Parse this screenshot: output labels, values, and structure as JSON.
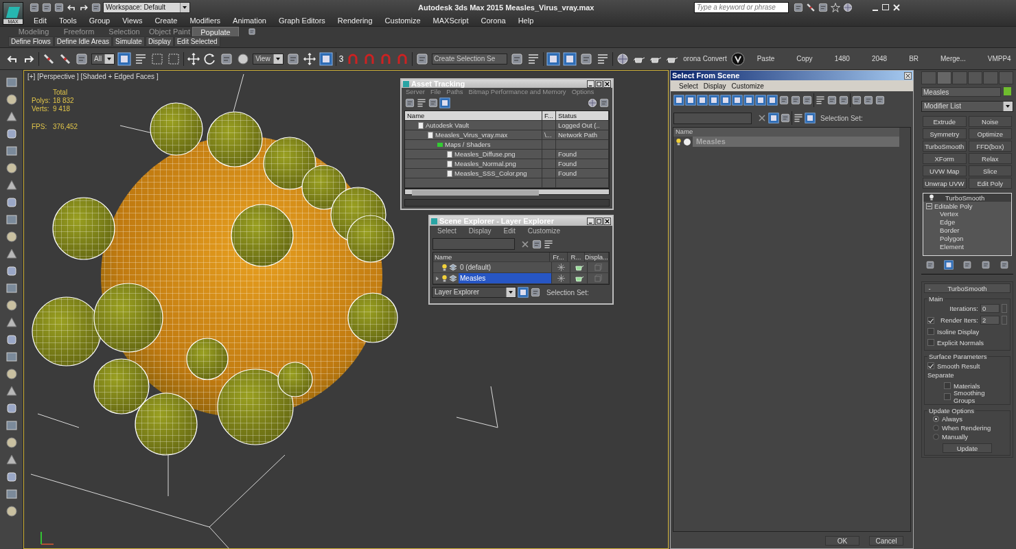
{
  "title_bar": {
    "logo_label": "MAX",
    "workspace": "Workspace: Default",
    "title": "Autodesk 3ds Max  2015    Measles_Virus_vray.max",
    "search": {
      "placeholder": "Type a keyword or phrase"
    }
  },
  "menu_bar": [
    "Edit",
    "Tools",
    "Group",
    "Views",
    "Create",
    "Modifiers",
    "Animation",
    "Graph Editors",
    "Rendering",
    "Customize",
    "MAXScript",
    "Corona",
    "Help"
  ],
  "ribbon": {
    "tabs": [
      {
        "label": "Modeling",
        "selected": false
      },
      {
        "label": "Freeform",
        "selected": false
      },
      {
        "label": "Selection",
        "selected": false
      },
      {
        "label": "Object Paint",
        "selected": false
      },
      {
        "label": "Populate",
        "selected": true
      }
    ],
    "buttons": [
      "Define Flows",
      "Define Idle Areas",
      "Simulate",
      "Display",
      "Edit Selected"
    ]
  },
  "main_toolbar": {
    "selection_filter": "All",
    "reference_coord": "View",
    "snap_label": "3",
    "selection_set": {
      "placeholder": "Create Selection Se"
    },
    "text_buttons": [
      "Paste",
      "Copy",
      "1480",
      "2048",
      "BR",
      "Merge...",
      "VMPP4"
    ],
    "corona_button": "orona Convert"
  },
  "viewport": {
    "label": "[+] [Perspective ] [Shaded + Edged Faces ]",
    "stats": {
      "header": "Total",
      "rows": [
        {
          "label": "Polys:",
          "value": "18 832"
        },
        {
          "label": "Verts:",
          "value": "9 418"
        }
      ],
      "fps_label": "FPS:",
      "fps": "376,452"
    }
  },
  "asset_tracking": {
    "title": "Asset Tracking",
    "menu": [
      "Server",
      "File",
      "Paths",
      "Bitmap Performance and Memory",
      "Options"
    ],
    "columns": [
      "Name",
      "F...",
      "Status"
    ],
    "rows": [
      {
        "name": "Autodesk Vault",
        "status": "Logged Out (..",
        "children": [
          {
            "name": "Measles_Virus_vray.max",
            "file": "\\...",
            "status": "Network Path",
            "children": [
              {
                "name": "Maps / Shaders",
                "children": [
                  {
                    "name": "Measles_Diffuse.png",
                    "status": "Found"
                  },
                  {
                    "name": "Measles_Normal.png",
                    "status": "Found"
                  },
                  {
                    "name": "Measles_SSS_Color.png",
                    "status": "Found"
                  }
                ]
              }
            ]
          }
        ]
      }
    ]
  },
  "scene_explorer": {
    "title": "Scene Explorer - Layer Explorer",
    "menu": [
      "Select",
      "Display",
      "Edit",
      "Customize"
    ],
    "columns": [
      "Name",
      "Fr...",
      "R...",
      "Displa..."
    ],
    "rows": [
      {
        "name": "0 (default)",
        "selected": false,
        "has_children": false
      },
      {
        "name": "Measles",
        "selected": true,
        "has_children": true
      }
    ],
    "explorer_dropdown": "Layer Explorer",
    "selection_set": "Selection Set:"
  },
  "select_from_scene": {
    "title": "Select From Scene",
    "menu": [
      "Select",
      "Display",
      "Customize"
    ],
    "selection_set": "Selection Set:",
    "column": "Name",
    "rows": [
      {
        "name": "Measles",
        "selected": true
      }
    ],
    "buttons": [
      "OK",
      "Cancel"
    ]
  },
  "command_panel": {
    "object_name": "Measles",
    "modifier_list": "Modifier List",
    "modifier_buttons": [
      "Extrude",
      "Noise",
      "Symmetry",
      "Optimize",
      "TurboSmooth",
      "FFD(box)",
      "XForm",
      "Relax",
      "UVW Map",
      "Slice",
      "Unwrap UVW",
      "Edit Poly"
    ],
    "stack": {
      "top": "TurboSmooth",
      "base": {
        "name": "Editable Poly",
        "expanded": true,
        "children": [
          "Vertex",
          "Edge",
          "Border",
          "Polygon",
          "Element"
        ]
      }
    },
    "rollout": {
      "collapse_sign": "-",
      "title": "TurboSmooth",
      "groups": [
        {
          "title": "Main",
          "items": [
            {
              "kind": "spinner",
              "label": "Iterations:",
              "value": "0"
            },
            {
              "kind": "checkspinner",
              "label": "Render Iters:",
              "checked": true,
              "value": "2"
            },
            {
              "kind": "checkbox",
              "label": "Isoline Display",
              "checked": false
            },
            {
              "kind": "checkbox",
              "label": "Explicit Normals",
              "checked": false
            }
          ]
        },
        {
          "title": "Surface Parameters",
          "items": [
            {
              "kind": "checkbox",
              "label": "Smooth Result",
              "checked": true
            },
            {
              "kind": "label",
              "label": "Separate"
            },
            {
              "kind": "subcheckbox",
              "label": "Materials",
              "checked": false
            },
            {
              "kind": "subcheckbox",
              "label": "Smoothing Groups",
              "checked": false
            }
          ]
        },
        {
          "title": "Update Options",
          "items": [
            {
              "kind": "radio",
              "label": "Always",
              "selected": true
            },
            {
              "kind": "radio",
              "label": "When Rendering",
              "selected": false
            },
            {
              "kind": "radio",
              "label": "Manually",
              "selected": false
            },
            {
              "kind": "button",
              "label": "Update"
            }
          ]
        }
      ]
    }
  }
}
